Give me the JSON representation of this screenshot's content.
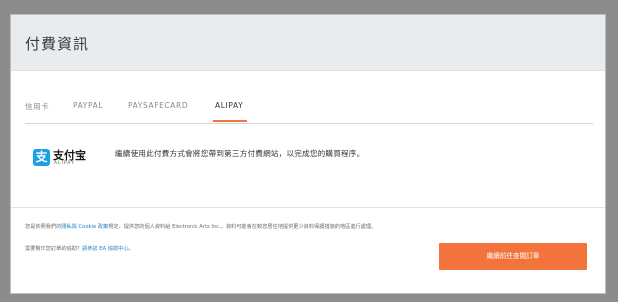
{
  "modal": {
    "title": "付費資訊"
  },
  "tabs": [
    {
      "label": "信用卡",
      "active": false
    },
    {
      "label": "PAYPAL",
      "active": false
    },
    {
      "label": "PAYSAFECARD",
      "active": false
    },
    {
      "label": "ALIPAY",
      "active": true
    }
  ],
  "alipay": {
    "logo_text": "支付宝",
    "logo_sub": "ALIPAY",
    "logo_glyph": "支",
    "message": "繼續使用此付費方式會將您帶到第三方付費網站，以完成您的購買程序。"
  },
  "legal": {
    "prefix": "您是依照我們的",
    "policy_link": "隱私與 Cookie 政策",
    "suffix": "規定，提供您的個人資料給 Electronic Arts Inc.，資料可能會在較您居住地提供更少資料保護措施的地區進行處理。"
  },
  "help": {
    "prefix": "需要幫忙您訂單的協助？",
    "help_link": "請參訪 EA 協助中心",
    "suffix": "。"
  },
  "actions": {
    "continue_label": "繼續前往查閱訂單"
  },
  "colors": {
    "accent": "#f2743c",
    "link": "#1a82c8",
    "alipay_blue": "#1aa0e8",
    "header_bg": "#e9ecef"
  }
}
